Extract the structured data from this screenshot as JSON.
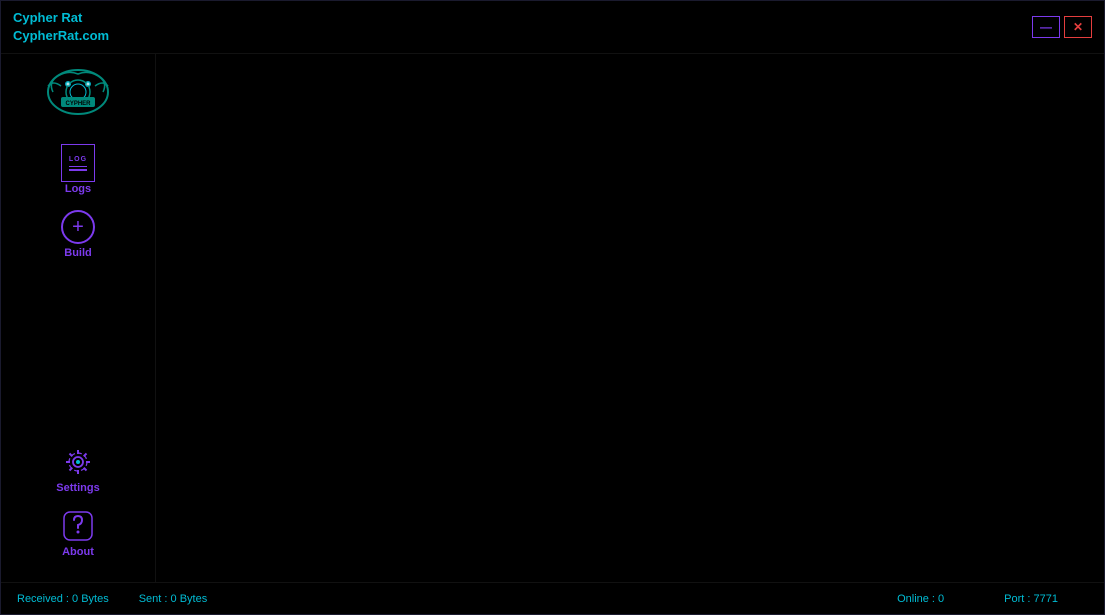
{
  "app": {
    "title_line1": "Cypher Rat",
    "title_line2": "CypherRat.com"
  },
  "window_controls": {
    "minimize_label": "—",
    "close_label": "✕"
  },
  "sidebar": {
    "nav_items": [
      {
        "id": "logs",
        "label": "Logs"
      },
      {
        "id": "build",
        "label": "Build"
      },
      {
        "id": "settings",
        "label": "Settings"
      },
      {
        "id": "about",
        "label": "About"
      }
    ]
  },
  "status_bar": {
    "received_label": "Received : 0 Bytes",
    "sent_label": "Sent : 0 Bytes",
    "online_label": "Online : 0",
    "port_label": "Port : 7771"
  }
}
